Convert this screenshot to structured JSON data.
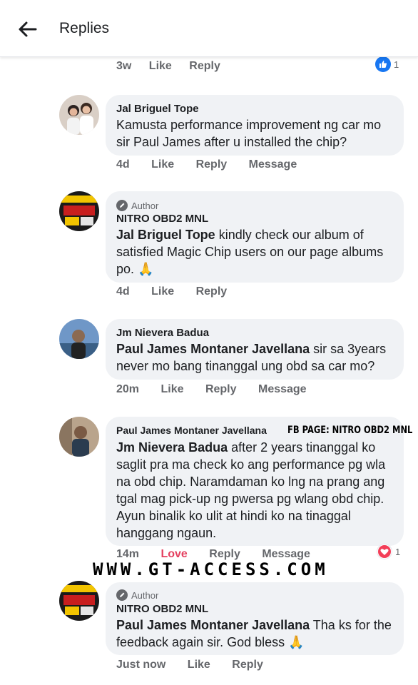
{
  "header": {
    "title": "Replies"
  },
  "top_actions": {
    "time": "3w",
    "like": "Like",
    "reply": "Reply",
    "reaction_count": "1"
  },
  "comments": [
    {
      "name": "Jal Briguel Tope",
      "text": "Kamusta performance improvement ng car mo sir Paul James after u installed the chip?",
      "time": "4d",
      "like": "Like",
      "reply": "Reply",
      "message": "Message"
    },
    {
      "author_badge": "Author",
      "name": "NITRO OBD2 MNL",
      "mention": "Jal Briguel Tope",
      "text": " kindly check our album of satisfied Magic Chip users on our page albums po. 🙏",
      "time": "4d",
      "like": "Like",
      "reply": "Reply"
    },
    {
      "name": "Jm Nievera Badua",
      "mention": "Paul James Montaner Javellana",
      "text": " sir sa 3years never mo bang tinanggal ung obd sa car mo?",
      "time": "20m",
      "like": "Like",
      "reply": "Reply",
      "message": "Message"
    },
    {
      "name": "Paul James Montaner Javellana",
      "mention": "Jm Nievera Badua",
      "text": " after 2 years tinanggal ko saglit pra ma check ko ang performance pg wla na obd chip. Naramdaman ko lng na prang ang tgal mag pick-up ng pwersa pg wlang obd chip. Ayun binalik ko ulit at hindi ko na tinaggal hanggang ngaun.",
      "time": "14m",
      "love": "Love",
      "reply": "Reply",
      "message": "Message",
      "reaction_count": "1"
    },
    {
      "author_badge": "Author",
      "name": "NITRO OBD2 MNL",
      "mention": "Paul James Montaner Javellana",
      "text": " Tha ks for the feedback again sir. God bless 🙏",
      "time": "Just now",
      "like": "Like",
      "reply": "Reply"
    }
  ],
  "watermarks": {
    "fb_page": "FB PAGE: NITRO OBD2 MNL",
    "url": "WWW.GT-ACCESS.COM"
  },
  "colors": {
    "like_blue": "#1877f2",
    "love_red": "#e4405f",
    "bubble_gray": "#f0f2f5",
    "meta_gray": "#65676b"
  },
  "icons": [
    "back-arrow-icon",
    "like-reaction-icon",
    "heart-reaction-icon",
    "pencil-icon"
  ]
}
